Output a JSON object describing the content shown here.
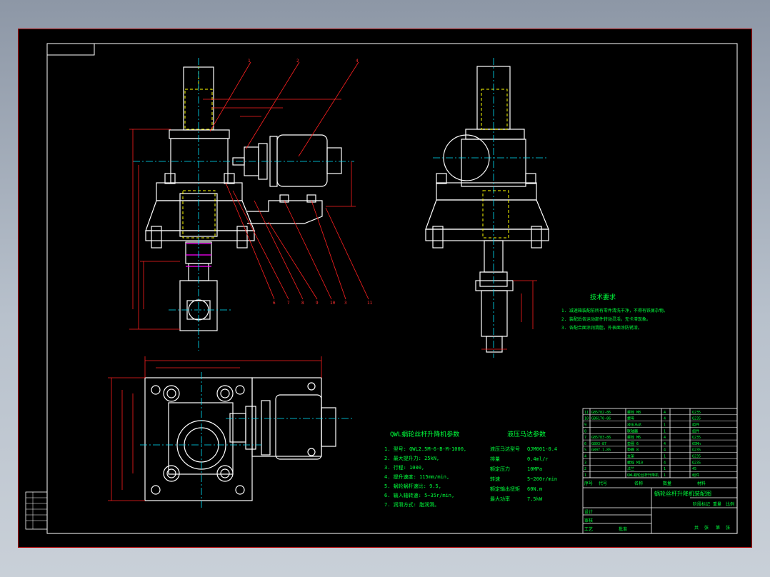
{
  "technical_requirements": {
    "title": "技术要求",
    "items": [
      "1. 减速箱装配前所有零件清洗干净，不得有铁屑杂物。",
      "2. 装配后各运动部件转动灵活，无卡滞现象。",
      "3. 各配合面涂润滑脂，外表面涂防锈漆。"
    ]
  },
  "params_left": {
    "title": "QWL蜗轮丝杆升降机参数",
    "items": [
      "1. 型号: QWL2.5M-6-B-M-1000,",
      "2. 最大提升力: 25kN,",
      "3. 行程: 1000,",
      "4. 提升速度: 115mm/min,",
      "5. 蜗轮蜗杆速比: 9.5,",
      "6. 输入轴转速: 5~35r/min,",
      "7. 润滑方式: 脂润滑。"
    ]
  },
  "params_right": {
    "title": "液压马达参数",
    "rows": [
      {
        "label": "液压马达型号",
        "value": "QJM001-0.4"
      },
      {
        "label": "排量",
        "value": "0.4ml/r"
      },
      {
        "label": "额定压力",
        "value": "10MPa"
      },
      {
        "label": "转速",
        "value": "5~200r/min"
      },
      {
        "label": "额定输出扭矩",
        "value": "60N.m"
      },
      {
        "label": "最大功率",
        "value": "7.5kW"
      }
    ]
  },
  "title_block": {
    "drawing_name": "蜗轮丝杆升降机装配图",
    "parts": [
      {
        "no": "11",
        "code": "GB5782-86",
        "name": "螺栓 M8",
        "qty": "4",
        "mat": "Q235"
      },
      {
        "no": "10",
        "code": "GB6170-86",
        "name": "螺母",
        "qty": "4",
        "mat": "Q235"
      },
      {
        "no": "9",
        "code": "",
        "name": "液压马达",
        "qty": "1",
        "mat": "组件"
      },
      {
        "no": "8",
        "code": "",
        "name": "联轴器",
        "qty": "1",
        "mat": "组件"
      },
      {
        "no": "7",
        "code": "GB5783-86",
        "name": "螺栓 M6",
        "qty": "4",
        "mat": "Q235"
      },
      {
        "no": "6",
        "code": "GB93-87",
        "name": "垫圈 6",
        "qty": "4",
        "mat": "65Mn"
      },
      {
        "no": "5",
        "code": "GB97.1-85",
        "name": "垫圈 8",
        "qty": "4",
        "mat": "Q235"
      },
      {
        "no": "4",
        "code": "",
        "name": "支架",
        "qty": "1",
        "mat": "Q235"
      },
      {
        "no": "3",
        "code": "",
        "name": "螺栓 M10",
        "qty": "4",
        "mat": "Q235"
      },
      {
        "no": "2",
        "code": "",
        "name": "法兰",
        "qty": "1",
        "mat": "45"
      },
      {
        "no": "1",
        "code": "",
        "name": "QWL蜗轮丝杆升降机",
        "qty": "1",
        "mat": "组件"
      }
    ],
    "header": [
      "序号",
      "代号",
      "名称",
      "数量",
      "材料"
    ],
    "sign_labels": [
      "设计",
      "审核",
      "工艺",
      "批准"
    ],
    "stage_labels": [
      "阶段标记",
      "重量",
      "比例"
    ],
    "sheet_labels": [
      "共",
      "张",
      "第",
      "张"
    ]
  },
  "colors": {
    "outline": "#ffffff",
    "text": "#00ff3c",
    "leader": "#ff2020",
    "center": "#00e5ff",
    "hidden": "#ffff00",
    "dimension": "#ff2020",
    "shaft": "#ff00ff",
    "frame": "#aa0000"
  }
}
